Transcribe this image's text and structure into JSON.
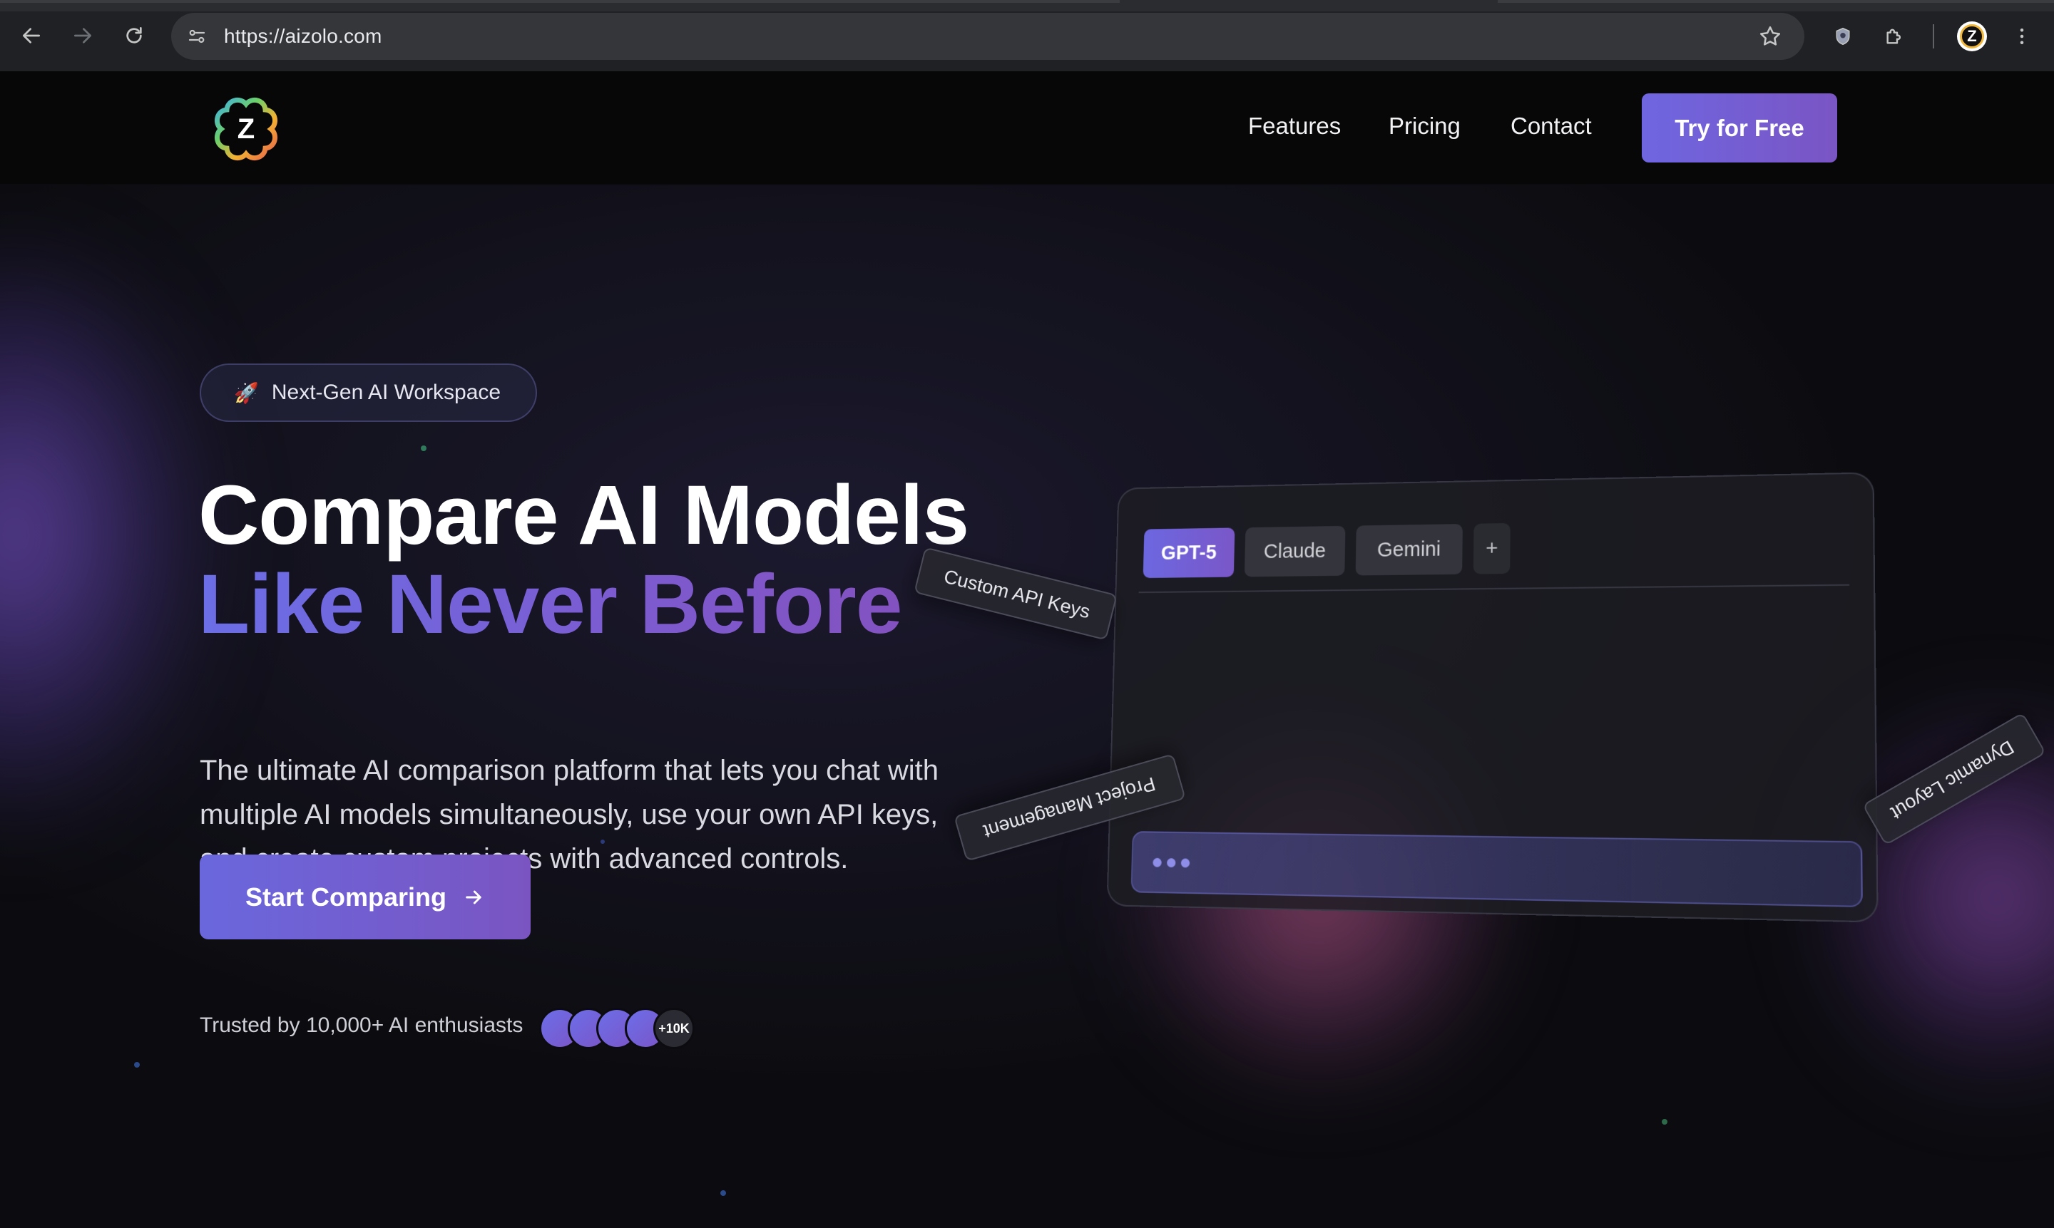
{
  "browser": {
    "url": "https://aizolo.com",
    "back_icon": "arrow-left-icon",
    "forward_icon": "arrow-right-icon",
    "reload_icon": "reload-icon"
  },
  "header": {
    "logo_letter": "Z",
    "nav": [
      {
        "label": "Features"
      },
      {
        "label": "Pricing"
      },
      {
        "label": "Contact"
      }
    ],
    "cta_label": "Try for Free"
  },
  "hero": {
    "badge_emoji": "🚀",
    "badge_text": "Next-Gen AI Workspace",
    "title_line1": "Compare AI Models",
    "title_line2": "Like Never Before",
    "description_lines": [
      "The ultimate AI comparison platform that lets you chat with",
      "multiple AI models simultaneously, use your own API keys,",
      "and create custom projects with advanced controls."
    ],
    "cta_label": "Start Comparing",
    "trusted_text": "Trusted by 10,000+ AI enthusiasts",
    "avatar_count_label": "+10K"
  },
  "mockup": {
    "tabs": [
      "GPT-5",
      "Claude",
      "Gemini"
    ],
    "add_tab_label": "+",
    "floating_tags": {
      "api_keys": "Custom API Keys",
      "project": "Project Management",
      "layout": "Dynamic Layout"
    }
  },
  "colors": {
    "accent_start": "#6b6ee6",
    "accent_end": "#7a55c4",
    "background": "#0c0c10"
  }
}
